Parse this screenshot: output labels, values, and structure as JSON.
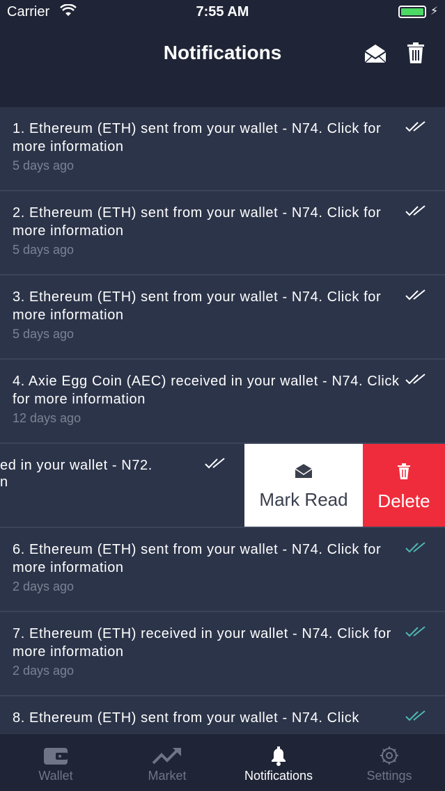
{
  "status_bar": {
    "carrier": "Carrier",
    "time": "7:55 AM"
  },
  "header": {
    "title": "Notifications",
    "mail_icon": "envelope-open-icon",
    "trash_icon": "trash-icon"
  },
  "notifications": [
    {
      "message": "1. Ethereum (ETH) sent from your wallet - N74. Click for more information",
      "time": "5 days ago",
      "read": true
    },
    {
      "message": "2. Ethereum (ETH) sent from your wallet - N74. Click for more information",
      "time": "5 days ago",
      "read": true
    },
    {
      "message": "3. Ethereum (ETH) sent from your wallet - N74. Click for more information",
      "time": "5 days ago",
      "read": true
    },
    {
      "message": "4. Axie Egg Coin (AEC) received in your wallet - N74. Click for more information",
      "time": "12 days ago",
      "read": true
    },
    {
      "message_visible_line1": "ed in your wallet - N72.",
      "message_visible_line2": "n",
      "read": true,
      "swiped": true
    },
    {
      "message": "6. Ethereum (ETH) sent from your wallet - N74. Click for more information",
      "time": "2 days ago",
      "read": false
    },
    {
      "message": "7. Ethereum (ETH) received in your wallet - N74. Click for more information",
      "time": "2 days ago",
      "read": false
    },
    {
      "message": "8. Ethereum (ETH) sent from your wallet - N74. Click",
      "read": false
    }
  ],
  "swipe_actions": {
    "mark_read": "Mark Read",
    "delete": "Delete"
  },
  "tab_bar": {
    "tabs": [
      {
        "label": "Wallet",
        "icon": "wallet-icon"
      },
      {
        "label": "Market",
        "icon": "trend-icon"
      },
      {
        "label": "Notifications",
        "icon": "bell-icon",
        "active": true
      },
      {
        "label": "Settings",
        "icon": "gear-icon"
      }
    ]
  },
  "colors": {
    "background": "#262d42",
    "bar": "#1f2536",
    "row": "#2c3449",
    "delete": "#ef2c3b",
    "unread_check": "#4fb8b0",
    "read_check": "#ffffff",
    "muted": "#7a8295"
  }
}
